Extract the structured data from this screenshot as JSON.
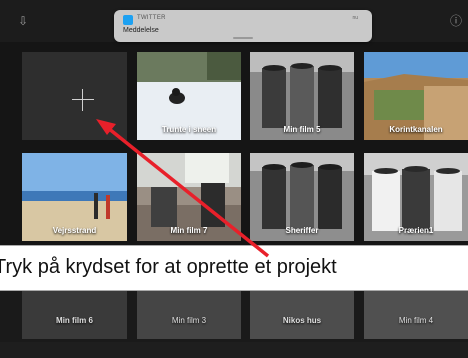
{
  "notification": {
    "app": "TWITTER",
    "time": "nu",
    "message": "Meddelelse"
  },
  "new_project": {
    "label": "+"
  },
  "projects_row1": [
    "Trunte i sneen",
    "Min film 5",
    "Korintkanalen"
  ],
  "projects_row2": [
    "Vejrsstrand",
    "Min film 7",
    "Sheriffer",
    "Prærien1"
  ],
  "projects_row3": [
    "Min film 6",
    "Min film 3",
    "Nikos hus",
    "Min film 4"
  ],
  "instruction": "Tryk på krydset for at oprette et projekt",
  "icons": {
    "import": "import-icon",
    "add": "plus-icon",
    "info": "info-icon"
  },
  "colors": {
    "background": "#151515",
    "arrow": "#e8202a",
    "notification": "#c9c9c9"
  }
}
